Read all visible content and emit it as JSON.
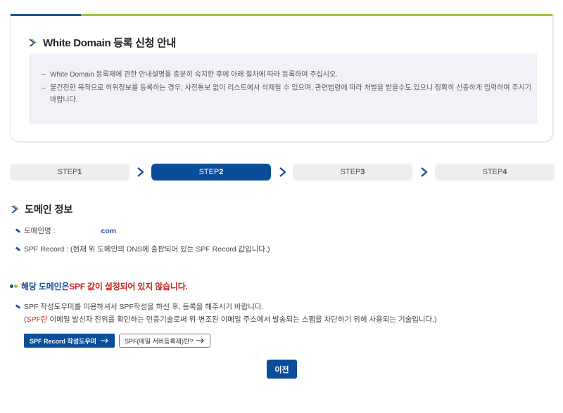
{
  "notice": {
    "title": "White Domain 등록 신청 안내",
    "items": [
      "White Domain 등록제에 관한 안내설명을 충분히 숙지한 후에 아래 절차에 따라 등록하여 주십시오.",
      "불건전한 목적으로 허위정보를 등록하는 경우, 사전통보 없이 리스트에서 삭제될 수 있으며, 관련법령에 따라 처벌을 받을수도 있으니 정확히 신중하게 입력하여 주시기 바랍니다."
    ]
  },
  "steps": [
    {
      "prefix": "STEP",
      "num": "1",
      "active": false
    },
    {
      "prefix": "STEP",
      "num": "2",
      "active": true
    },
    {
      "prefix": "STEP",
      "num": "3",
      "active": false
    },
    {
      "prefix": "STEP",
      "num": "4",
      "active": false
    }
  ],
  "domain_info": {
    "title": "도메인 정보",
    "domain_label": "도메인명 :",
    "domain_value": "com",
    "spf_label": "SPF Record : (현재 위 도메인의 DNS에 출판되어 있는 SPF Record 값입니다.)"
  },
  "warning": {
    "part1": "해당 도메인은 ",
    "part2": "SPF 값이 설정되어 있지 않습니다."
  },
  "guide": {
    "line1": "SPF 작성도우미를 이용하셔서 SPF작성을 하신 후, 등록을 해주시기 바랍니다.",
    "line2_open": "(",
    "line2_red": "SPF란",
    "line2_rest": " 이메일 발신자 진위를 확인하는 인증기술로써 위·변조된 이메일 주소에서 발송되는 스팸을 차단하기 위해 사용되는 기술입니다.)"
  },
  "buttons": {
    "spf_helper": "SPF Record 작성도우미",
    "spf_info": "SPF(메일 서버등록제)란?",
    "prev": "이전"
  },
  "colors": {
    "brand_blue": "#0a4d9b",
    "brand_green": "#9fc63b",
    "warning_red": "#c8231b"
  }
}
